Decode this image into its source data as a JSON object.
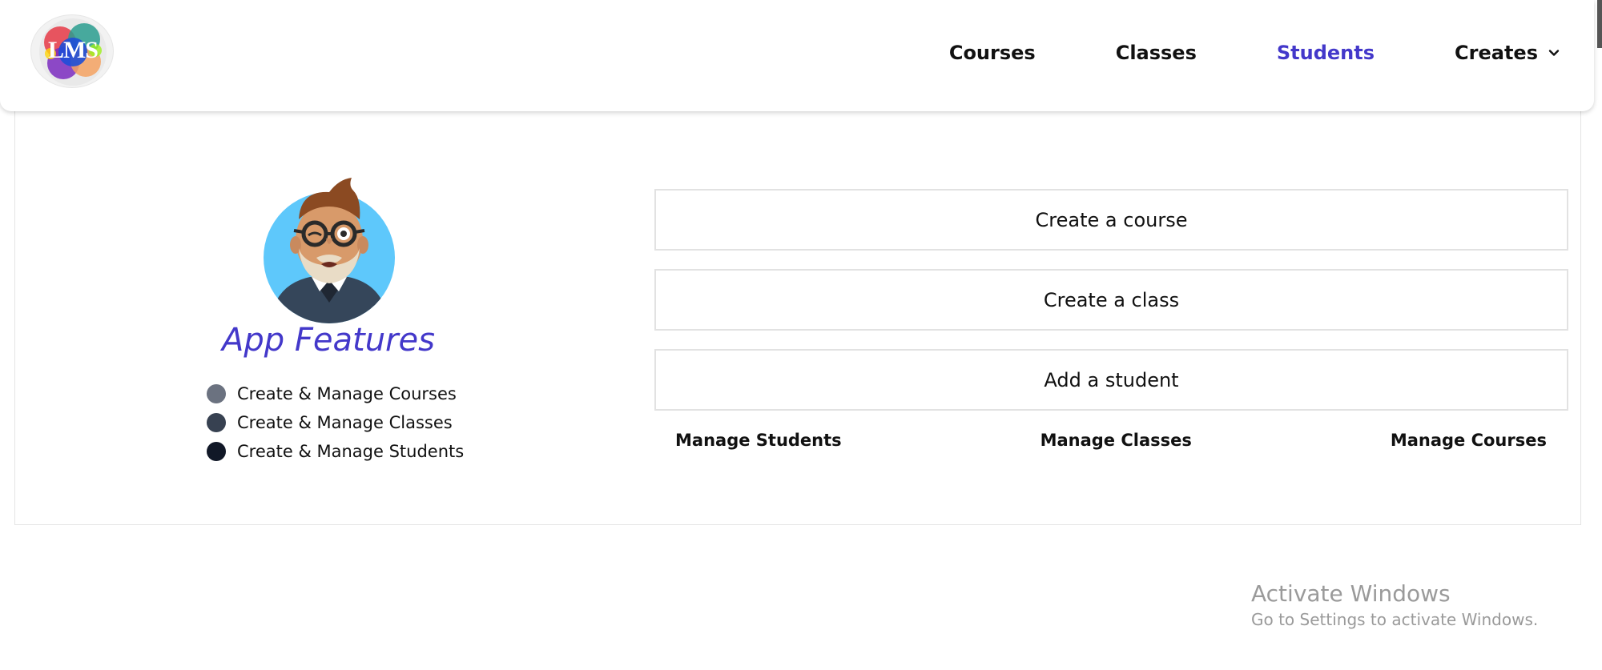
{
  "header": {
    "logo_text": "LMS",
    "nav": [
      {
        "label": "Courses"
      },
      {
        "label": "Classes"
      },
      {
        "label": "Students"
      },
      {
        "label": "Creates"
      }
    ],
    "active_nav": "Students",
    "accent_color": "#4338ca"
  },
  "features": {
    "title": "App Features",
    "items": [
      {
        "label": "Create & Manage Courses",
        "dot_color": "#6b7280"
      },
      {
        "label": "Create & Manage Classes",
        "dot_color": "#374151"
      },
      {
        "label": "Create & Manage Students",
        "dot_color": "#111827"
      }
    ]
  },
  "actions": {
    "buttons": [
      {
        "label": "Create a course"
      },
      {
        "label": "Create a class"
      },
      {
        "label": "Add a student"
      }
    ],
    "links": [
      {
        "label": "Manage Students"
      },
      {
        "label": "Manage Classes"
      },
      {
        "label": "Manage Courses"
      }
    ]
  },
  "watermark": {
    "title": "Activate Windows",
    "subtitle": "Go to Settings to activate Windows."
  }
}
